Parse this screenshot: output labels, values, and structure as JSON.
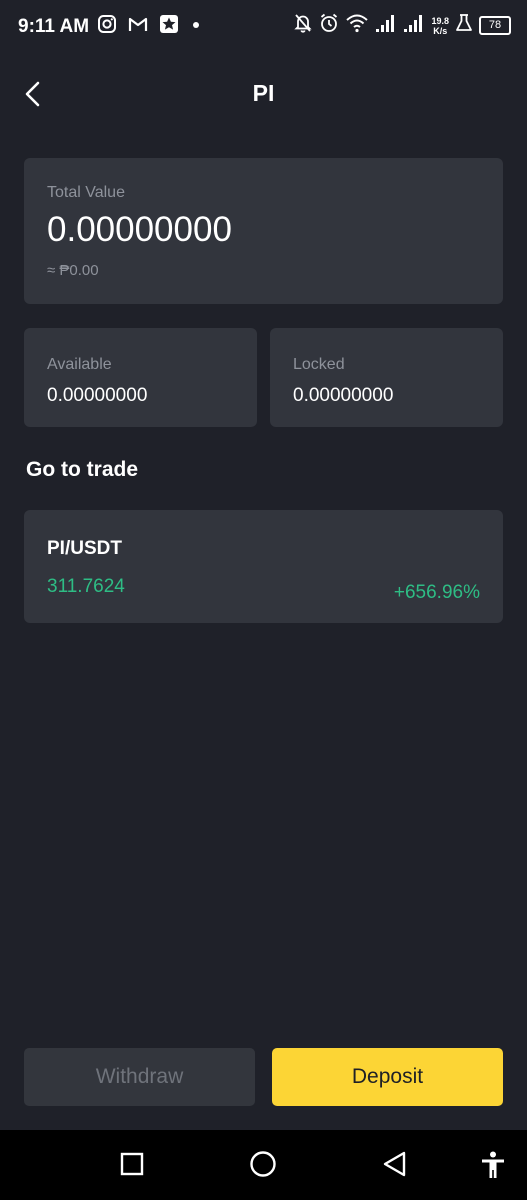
{
  "status_bar": {
    "time": "9:11 AM",
    "net_speed_value": "19.8",
    "net_speed_unit": "K/s",
    "battery": "78",
    "left_icons": [
      "instagram-icon",
      "gmail-icon",
      "star-app-icon",
      "dot-icon"
    ],
    "right_icons": [
      "bell-off-icon",
      "alarm-icon",
      "wifi-icon",
      "signal-icon",
      "signal-icon",
      "flask-icon",
      "battery-icon"
    ]
  },
  "header": {
    "title": "PI",
    "back_icon": "chevron-left-icon"
  },
  "total": {
    "label": "Total Value",
    "value": "0.00000000",
    "fiat": "≈ ₱0.00"
  },
  "available": {
    "label": "Available",
    "value": "0.00000000"
  },
  "locked": {
    "label": "Locked",
    "value": "0.00000000"
  },
  "trade": {
    "section_title": "Go to trade",
    "pair": "PI/USDT",
    "price": "311.7624",
    "change": "+656.96%"
  },
  "actions": {
    "withdraw": "Withdraw",
    "deposit": "Deposit"
  },
  "nav_bar": {
    "icons": [
      "recents-icon",
      "home-icon",
      "back-icon",
      "accessibility-icon"
    ]
  },
  "colors": {
    "background": "#1f2129",
    "card": "#32353d",
    "accent": "#fcd535",
    "positive": "#2ebd85",
    "muted": "#8e929b"
  }
}
